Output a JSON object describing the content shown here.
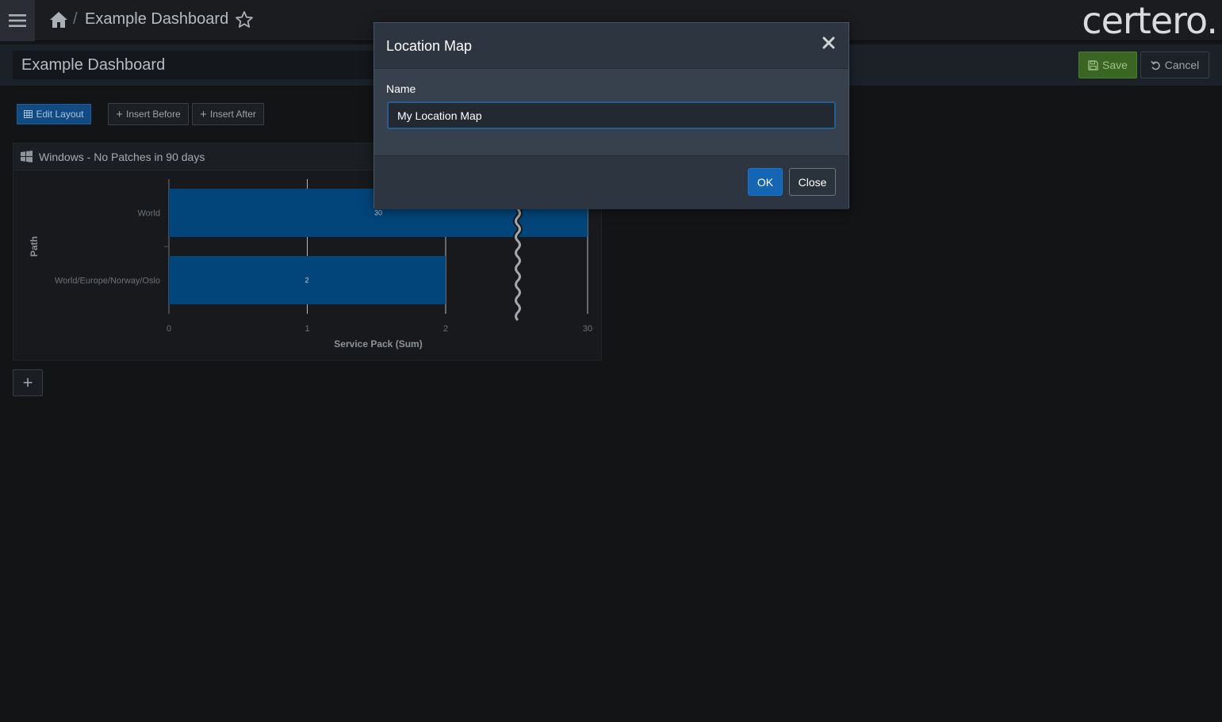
{
  "header": {
    "breadcrumb_separator": "/",
    "dashboard_title": "Example Dashboard",
    "logo_text": "certero."
  },
  "name_bar": {
    "dashboard_name": "Example Dashboard",
    "save_label": "Save",
    "cancel_label": "Cancel"
  },
  "toolbar": {
    "edit_layout_label": "Edit Layout",
    "insert_before_label": "Insert Before",
    "insert_after_label": "Insert After",
    "add_label": "+"
  },
  "widget": {
    "title": "Windows - No Patches in 90 days"
  },
  "chart_data": {
    "type": "bar",
    "orientation": "horizontal",
    "categories": [
      "World",
      "World/Europe/Norway/Oslo"
    ],
    "values": [
      30,
      2
    ],
    "data_labels": [
      "30",
      "2"
    ],
    "xlabel": "Service Pack (Sum)",
    "ylabel": "Path",
    "x_ticks": [
      "0",
      "1",
      "2",
      "30"
    ],
    "axis_break": true,
    "grid": true,
    "bar_color": "#02457a"
  },
  "modal": {
    "title": "Location Map",
    "field_label": "Name",
    "field_value": "My Location Map",
    "ok_label": "OK",
    "close_label": "Close"
  },
  "colors": {
    "primary": "#1565b5",
    "success": "#3a6522",
    "bar": "#02457a"
  },
  "icons": {
    "menu": "hamburger-icon",
    "home": "home-icon",
    "favorite": "star-icon",
    "save": "floppy-icon",
    "cancel": "undo-icon",
    "edit": "grid-icon",
    "widget": "windows-icon",
    "close": "close-icon"
  }
}
